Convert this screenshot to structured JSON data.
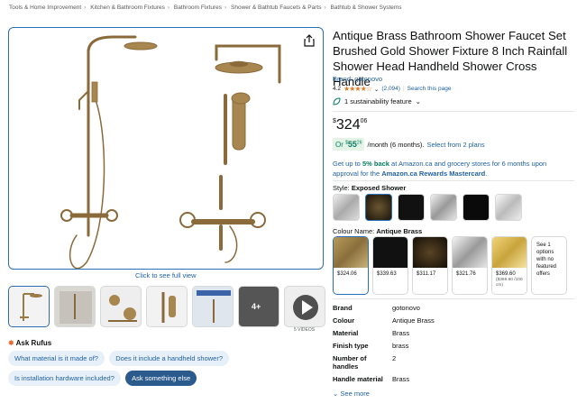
{
  "breadcrumb": [
    "Tools & Home Improvement",
    "Kitchen & Bathroom Fixtures",
    "Bathroom Fixtures",
    "Shower & Bathtub Faucets & Parts",
    "Bathtub & Shower Systems"
  ],
  "breadcrumb_sep": "›",
  "gallery": {
    "full_view": "Click to see full view",
    "thumb_more": "4+",
    "videos_label": "5 VIDEOS"
  },
  "rufus": {
    "title": "Ask Rufus",
    "chips": [
      "What material is it made of?",
      "Does it include a handheld shower?",
      "Is installation hardware included?",
      "Ask something else"
    ]
  },
  "product": {
    "title": "Antique Brass Bathroom Shower Faucet Set Brushed Gold Shower Fixture 8 Inch Rainfall Shower Head Handheld Shower Cross Handle",
    "brand": "Brand: gotonovo",
    "rating": "4.2",
    "stars": "★★★★☆",
    "reviews": "(2,094)",
    "search_page": "Search this page",
    "sustainability": "1 sustainability feature",
    "price_symbol": "$",
    "price_whole": "324",
    "price_frac": "06",
    "monthly_prefix": "Or",
    "monthly_whole": "55",
    "monthly_frac": "26",
    "monthly_suffix": "/month (6 months).",
    "monthly_link": "Select from 2 plans",
    "promo_a": "Get up to ",
    "promo_b": "5% back",
    "promo_c": " at Amazon.ca and grocery stores for 6 months upon approval for the ",
    "promo_d": "Amazon.ca Rewards Mastercard",
    "promo_e": ".",
    "style_key": "Style: ",
    "style_val": "Exposed Shower",
    "colour_key": "Colour Name: ",
    "colour_val": "Antique Brass",
    "colours": [
      {
        "price": "$324.06",
        "sub": ""
      },
      {
        "price": "$339.63",
        "sub": ""
      },
      {
        "price": "$311.17",
        "sub": ""
      },
      {
        "price": "$321.76",
        "sub": ""
      },
      {
        "price": "$369.60",
        "sub": "($369.60 /100 cm)"
      }
    ],
    "colours_more": "See 1 options with no featured offers",
    "specs": [
      {
        "k": "Brand",
        "v": "gotonovo"
      },
      {
        "k": "Colour",
        "v": "Antique Brass"
      },
      {
        "k": "Material",
        "v": "Brass"
      },
      {
        "k": "Finish type",
        "v": "brass"
      },
      {
        "k": "Number of handles",
        "v": "2"
      },
      {
        "k": "Handle material",
        "v": "Brass"
      }
    ],
    "see_more": "See more"
  },
  "colors": {
    "link": "#2162a1",
    "select": "#2a6ebb",
    "star": "#de7921",
    "green": "#067d62",
    "brass": "#9a7a45"
  },
  "icons": [
    "share-icon",
    "sustainability-leaf-icon",
    "chevron-down-icon",
    "play-icon",
    "rufus-icon"
  ]
}
